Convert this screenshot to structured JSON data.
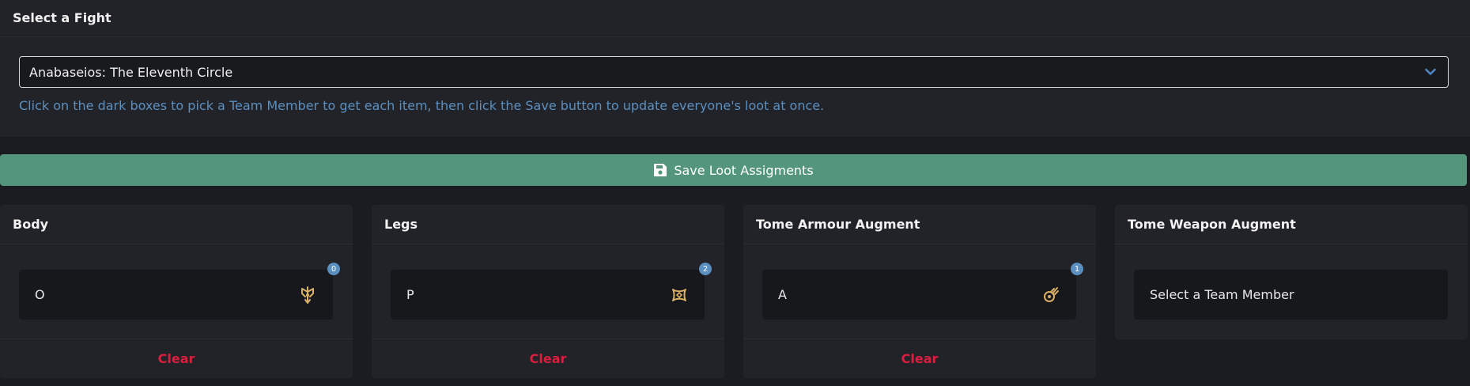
{
  "fight_panel": {
    "title": "Select a Fight",
    "selected_fight": "Anabaseios: The Eleventh Circle",
    "help_text": "Click on the dark boxes to pick a Team Member to get each item, then click the Save button to update everyone's loot at once."
  },
  "save_button": {
    "label": "Save Loot Assigments",
    "icon": "floppy-disk-icon"
  },
  "loot_cards": [
    {
      "title": "Body",
      "member": "O",
      "count": "0",
      "job_icon": "scholar-job-icon",
      "clear_label": "Clear"
    },
    {
      "title": "Legs",
      "member": "P",
      "count": "2",
      "job_icon": "reaper-job-icon",
      "clear_label": "Clear"
    },
    {
      "title": "Tome Armour Augment",
      "member": "A",
      "count": "1",
      "job_icon": "astrologian-job-icon",
      "clear_label": "Clear"
    },
    {
      "title": "Tome Weapon Augment",
      "member": "Select a Team Member"
    }
  ],
  "colors": {
    "accent_blue": "#5b8fc0",
    "save_green": "#54967c",
    "clear_red": "#d91e3e",
    "job_icon_gold": "#d9b066"
  }
}
